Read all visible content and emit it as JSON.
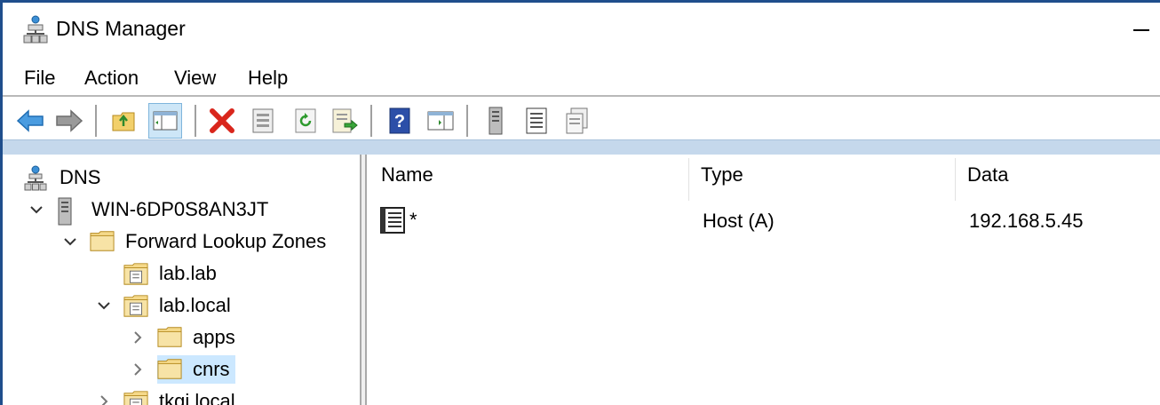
{
  "window": {
    "title": "DNS Manager"
  },
  "menu": {
    "file": "File",
    "action": "Action",
    "view": "View",
    "help": "Help"
  },
  "toolbar": {
    "buttons": [
      "back-icon",
      "forward-icon",
      "up-folder-icon",
      "show-hide-tree-icon",
      "delete-icon",
      "properties-icon",
      "refresh-icon",
      "export-list-icon",
      "help-icon",
      "show-hide-action-pane-icon",
      "server-icon",
      "record-icon",
      "zone-icon"
    ]
  },
  "tree": {
    "root": "DNS",
    "server": "WIN-6DP0S8AN3JT",
    "forward_zones": "Forward Lookup Zones",
    "zone_lab_lab": "lab.lab",
    "zone_lab_local": "lab.local",
    "folder_apps": "apps",
    "folder_cnrs": "cnrs",
    "zone_tkgi_local": "tkgi.local"
  },
  "list": {
    "columns": {
      "name": "Name",
      "type": "Type",
      "data": "Data"
    },
    "rows": [
      {
        "name": "*",
        "type": "Host (A)",
        "data": "192.168.5.45"
      }
    ]
  }
}
